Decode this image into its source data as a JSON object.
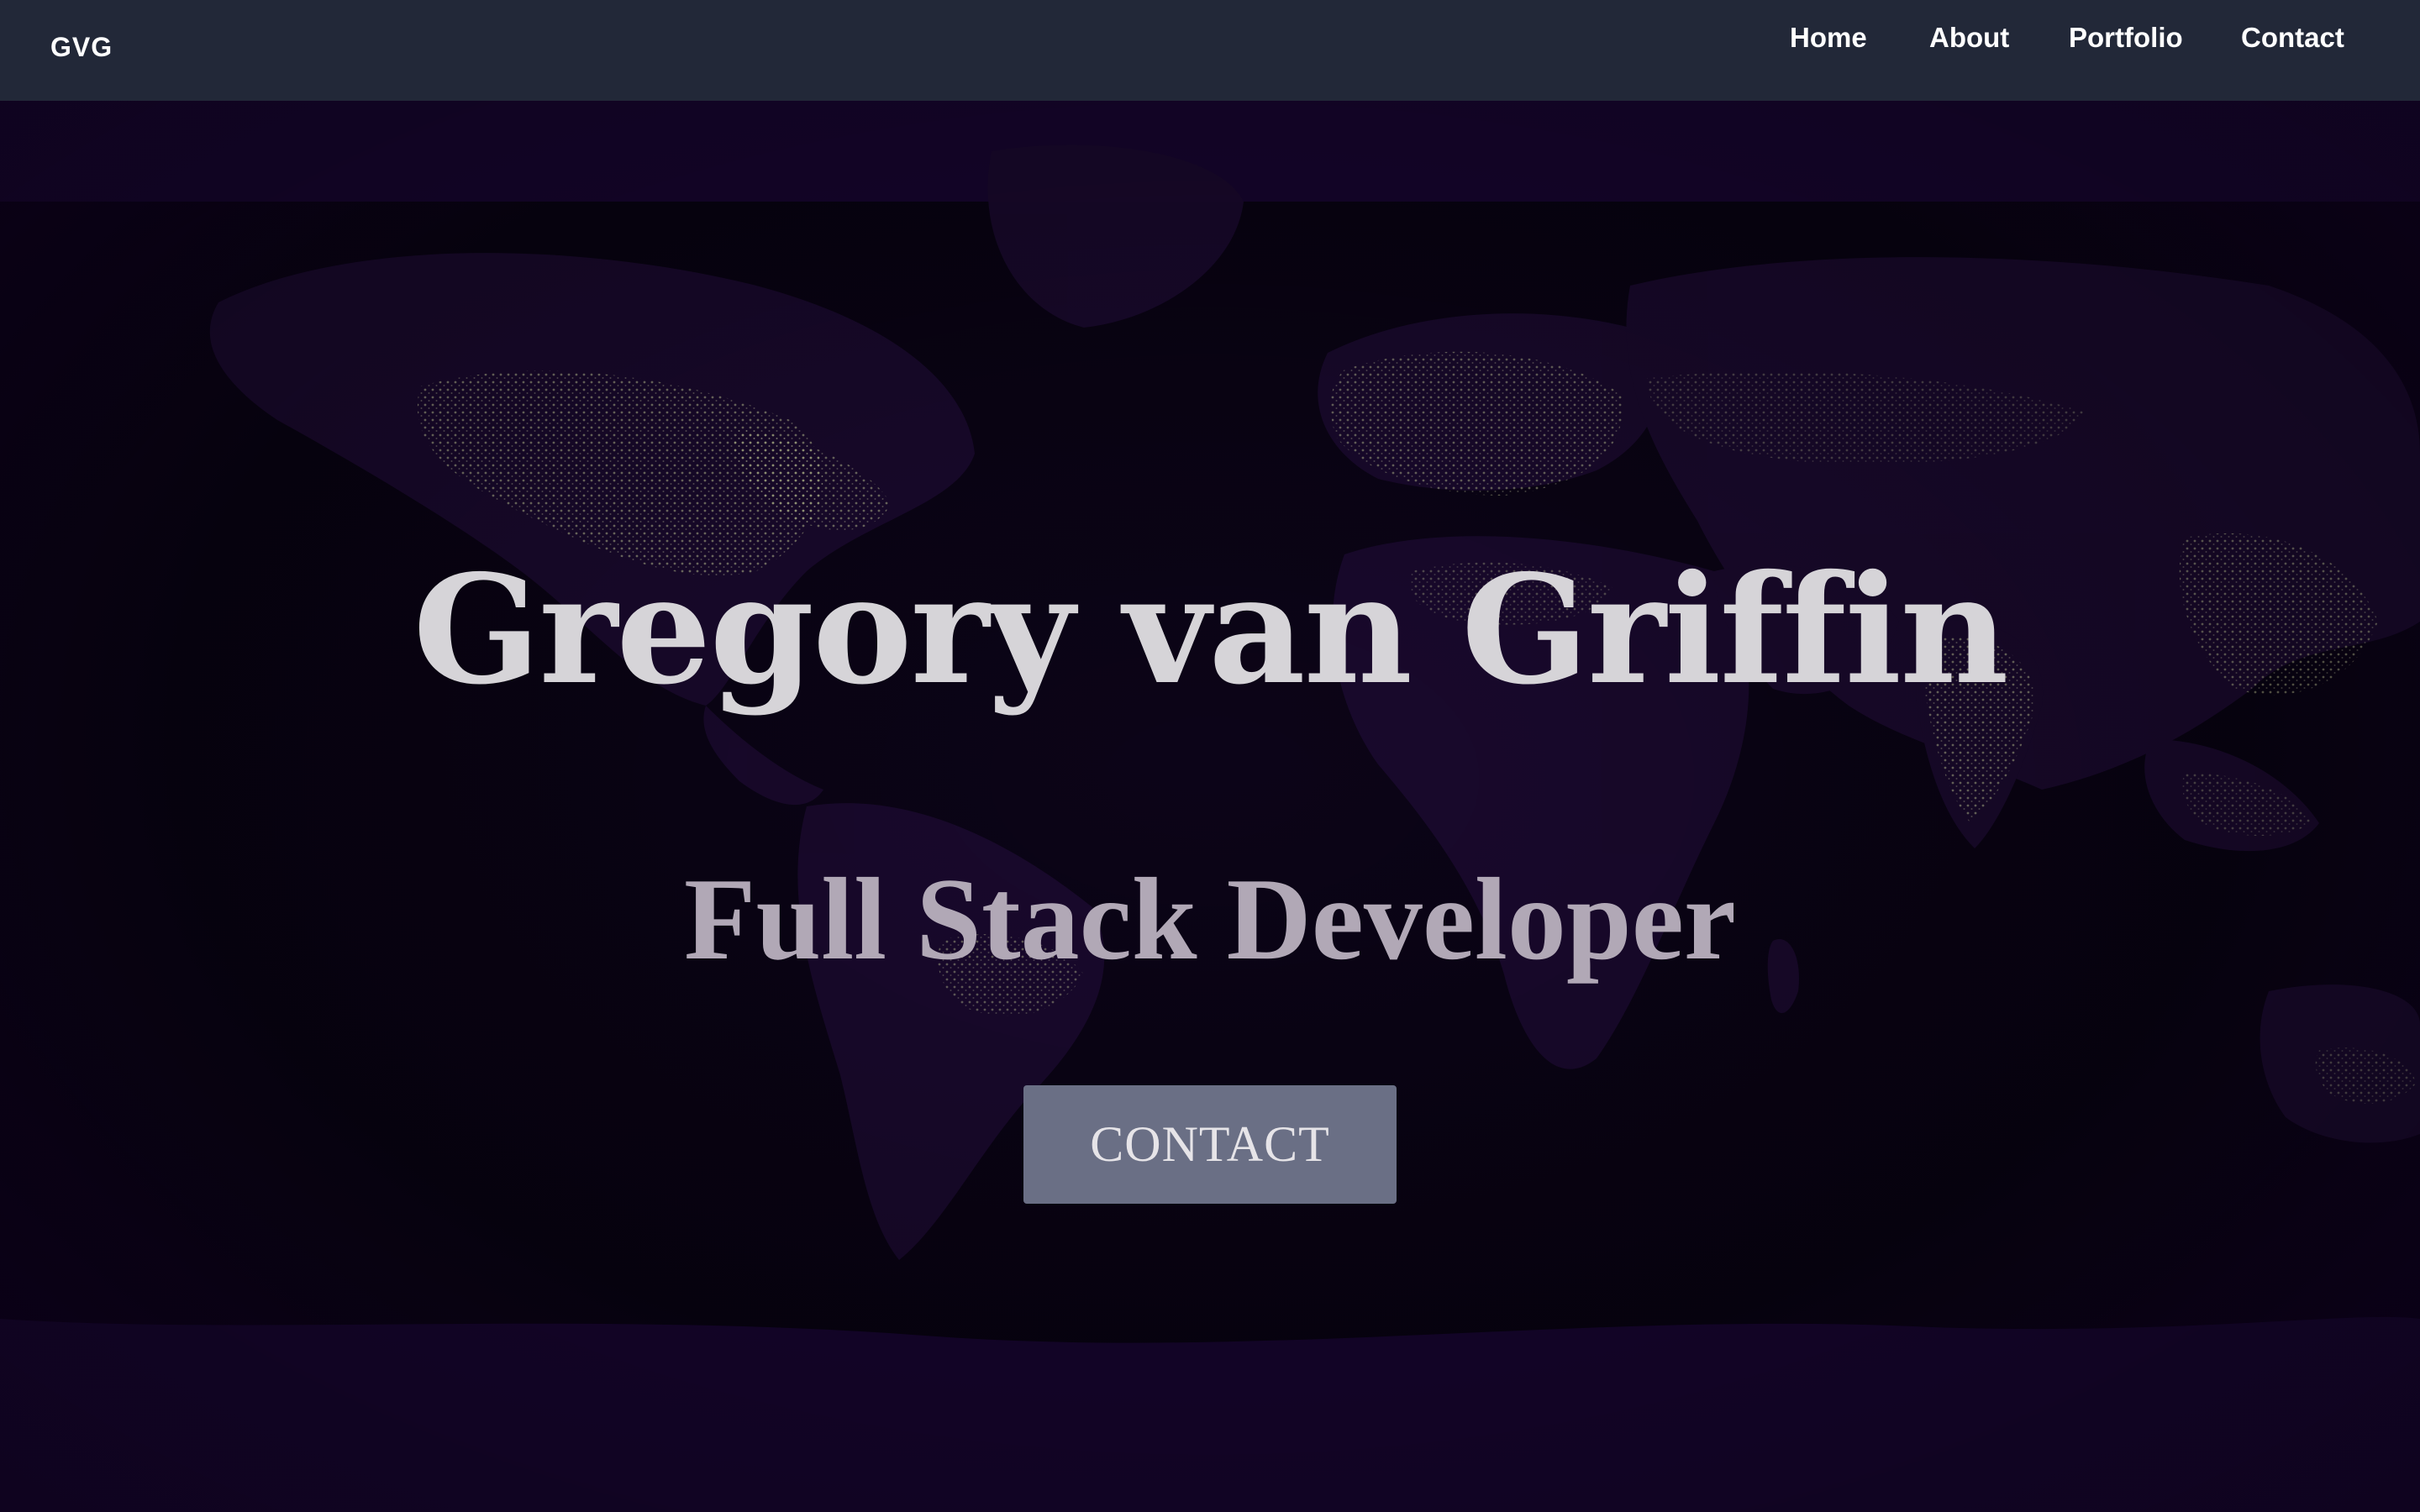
{
  "nav": {
    "brand": "GVG",
    "links": [
      {
        "label": "Home"
      },
      {
        "label": "About"
      },
      {
        "label": "Portfolio"
      },
      {
        "label": "Contact"
      }
    ]
  },
  "hero": {
    "background": "world-map-night-lights",
    "title": "Gregory van Griffin",
    "subtitle": "Full Stack Developer",
    "cta_label": "CONTACT"
  },
  "colors": {
    "navbar": "#222838",
    "hero_background": "#0b0015",
    "button": "#6a6f85",
    "title_text": "#d6d4d8",
    "subtitle_text": "#b1a8b6"
  }
}
